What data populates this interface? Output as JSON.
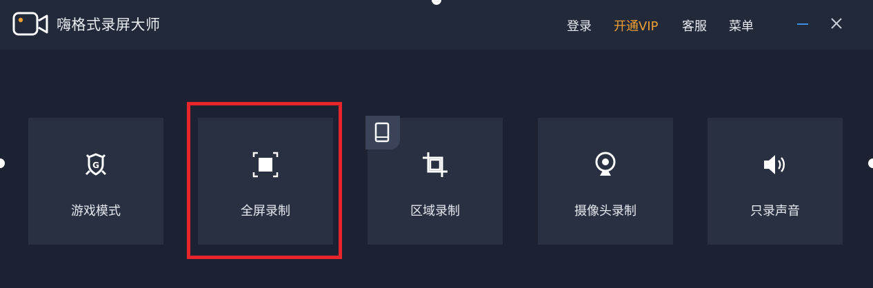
{
  "app": {
    "title": "嗨格式录屏大师",
    "logo_icon": "camera-icon",
    "accent_color": "#f0a033"
  },
  "nav": {
    "login": "登录",
    "vip": "开通VIP",
    "service": "客服",
    "menu": "菜单"
  },
  "window_controls": {
    "minimize_icon": "minimize-icon",
    "close_icon": "close-icon",
    "minimize_color": "#3a8ee6"
  },
  "modes": [
    {
      "label": "游戏模式",
      "icon": "game-shield-icon"
    },
    {
      "label": "全屏录制",
      "icon": "fullscreen-icon",
      "highlighted": true
    },
    {
      "label": "区域录制",
      "icon": "crop-icon",
      "badge_icon": "tablet-icon"
    },
    {
      "label": "摄像头录制",
      "icon": "webcam-icon"
    },
    {
      "label": "只录声音",
      "icon": "speaker-icon"
    }
  ],
  "highlight_color": "#e6262b"
}
